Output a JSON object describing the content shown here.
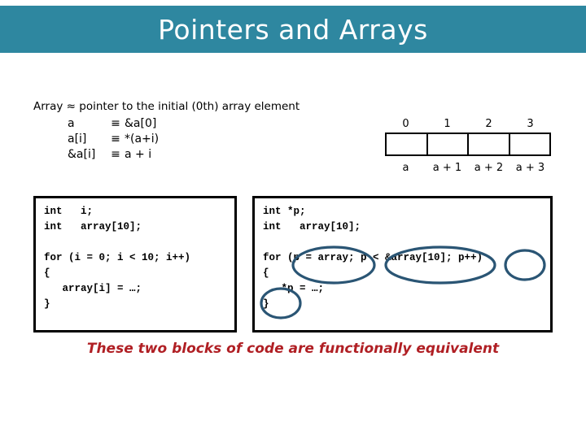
{
  "slide": {
    "title": "Pointers and Arrays",
    "title_bar_color": "#2e87a0",
    "background_color": "#ffffff"
  },
  "equivalences": {
    "heading": "Array ≈ pointer to the initial (0th) array element",
    "rows": [
      {
        "lhs": "a",
        "op": "≡",
        "rhs": "&a[0]"
      },
      {
        "lhs": "a[i]",
        "op": "≡",
        "rhs": "*(a+i)"
      },
      {
        "lhs": "&a[i]",
        "op": "≡",
        "rhs": "a + i"
      }
    ]
  },
  "array_diagram": {
    "indices": [
      "0",
      "1",
      "2",
      "3"
    ],
    "addresses": [
      "a",
      "a + 1",
      "a + 2",
      "a + 3"
    ],
    "cell_count": 4,
    "border_color": "#000000"
  },
  "code_left": {
    "lines": [
      "int   i;",
      "int   array[10];",
      "",
      "for (i = 0; i < 10; i++)",
      "{",
      "   array[i] = …;",
      "}"
    ]
  },
  "code_right": {
    "lines": [
      "int *p;",
      "int   array[10];",
      "",
      "for (p = array; p < &array[10]; p++)",
      "{",
      "   *p = …;",
      "}"
    ]
  },
  "annotations": {
    "ellipse_color": "#2a5574",
    "items": [
      {
        "label": "init-clause-ellipse",
        "target": "(p = array;"
      },
      {
        "label": "condition-clause-ellipse",
        "target": "p < &array[10]"
      },
      {
        "label": "increment-clause-ellipse",
        "target": "p++)"
      },
      {
        "label": "deref-ellipse",
        "target": "*p"
      }
    ]
  },
  "caption": {
    "text": "These two blocks of code are functionally equivalent",
    "color": "#b01f24"
  }
}
